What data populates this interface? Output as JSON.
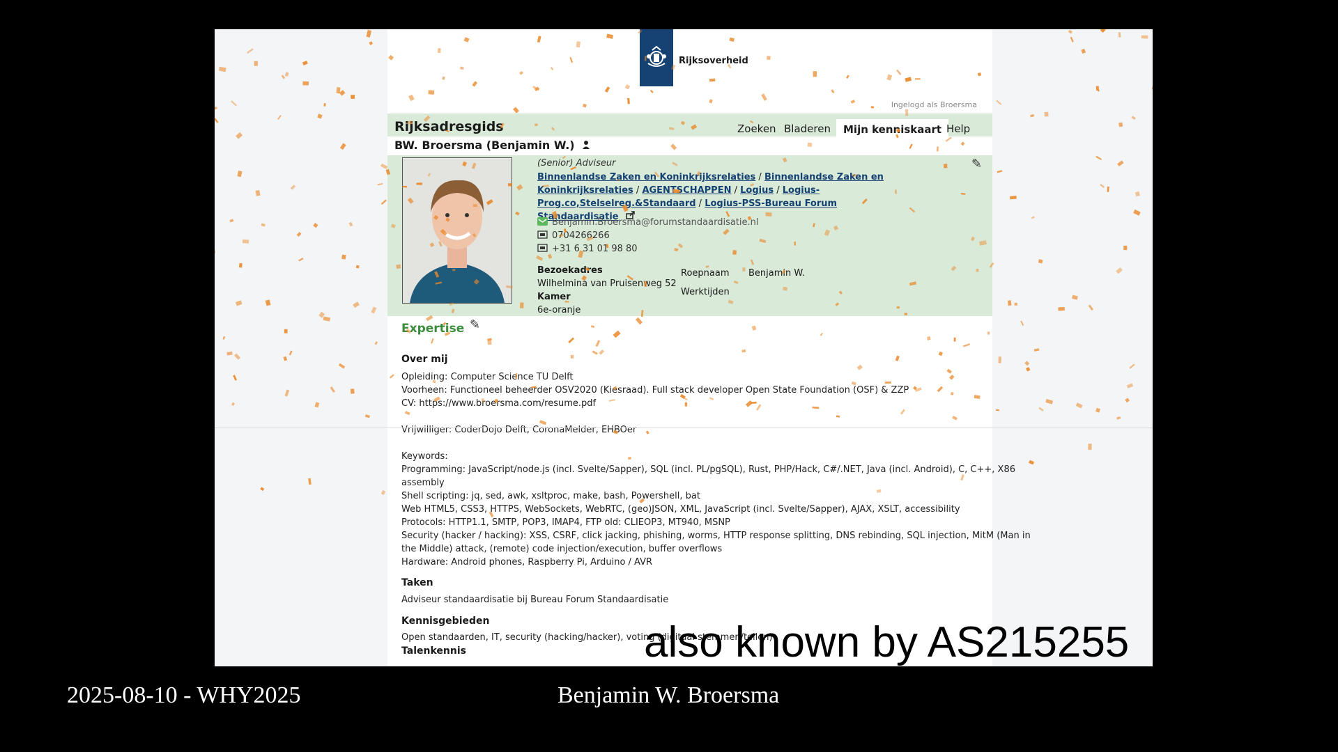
{
  "footer": {
    "date_event": "2025-08-10 - WHY2025",
    "speaker": "Benjamin W. Broersma"
  },
  "caption": "also known by AS215255",
  "colors": {
    "header_bg": "#d9ead8",
    "logo_bg": "#154273",
    "link": "#154273",
    "expertise": "#3b8d3b",
    "confetti": "#ea8a2c"
  },
  "site": {
    "logo_text": "Rijksoverheid",
    "logged_in": "Ingelogd als Broersma",
    "brand": "Rijksadresgids",
    "nav": [
      "Zoeken",
      "Bladeren",
      "Mijn kenniskaart",
      "Help"
    ],
    "active_nav": "Mijn kenniskaart"
  },
  "profile": {
    "name": "BW. Broersma (Benjamin W.)",
    "role": "(Senior) Adviseur",
    "org_path": [
      "Binnenlandse Zaken en Koninkrijksrelaties",
      "Binnenlandse Zaken en Koninkrijksrelaties",
      "AGENTSCHAPPEN",
      "Logius",
      "Logius-Prog.co,Stelselreg.&Standaard",
      "Logius-PSS-Bureau Forum Standaardisatie"
    ],
    "email": "Benjamin.Broersma@forumstandaardisatie.nl",
    "phone1": "0704266266",
    "phone2": "+31 6 31 01 98 80",
    "visit_address_label": "Bezoekadres",
    "visit_address": "Wilhelmina van Pruisenweg 52",
    "room_label": "Kamer",
    "room": "6e-oranje",
    "nickname_label": "Roepnaam",
    "nickname": "Benjamin W.",
    "hours_label": "Werktijden"
  },
  "expertise": {
    "title": "Expertise",
    "about_title": "Over mij",
    "about_lines": [
      "Opleiding: Computer Science TU Delft",
      "Voorheen: Functioneel beheerder OSV2020 (Kiesraad). Full stack developer Open State Foundation (OSF) & ZZP",
      "CV: https://www.broersma.com/resume.pdf",
      "",
      "Vrijwilliger: CoderDojo Delft, CoronaMelder, EHBOer",
      "",
      "Keywords:",
      "Programming: JavaScript/node.js (incl. Svelte/Sapper), SQL (incl. PL/pgSQL), Rust, PHP/Hack, C#/.NET, Java (incl. Android), C, C++, X86",
      "assembly",
      "Shell scripting: jq, sed, awk, xsltproc, make, bash, Powershell, bat",
      "Web HTML5, CSS3, HTTPS, WebSockets, WebRTC, (geo)JSON, XML, JavaScript (incl. Svelte/Sapper), AJAX, XSLT, accessibility",
      "Protocols: HTTP1.1, SMTP, POP3, IMAP4, FTP old: CLIEOP3, MT940, MSNP",
      "Security (hacker / hacking): XSS, CSRF, click jacking, phishing, worms, HTTP response splitting, DNS rebinding, SQL injection, MitM (Man in",
      "the Middle) attack, (remote) code injection/execution, buffer overflows",
      "Hardware: Android phones, Raspberry Pi, Arduino / AVR"
    ],
    "tasks_title": "Taken",
    "tasks": "Adviseur standaardisatie bij Bureau Forum Standaardisatie",
    "knowledge_title": "Kennisgebieden",
    "knowledge": "Open standaarden, IT, security (hacking/hacker), voting (digitaal stemmen/tellen)",
    "languages_title": "Talenkennis"
  }
}
